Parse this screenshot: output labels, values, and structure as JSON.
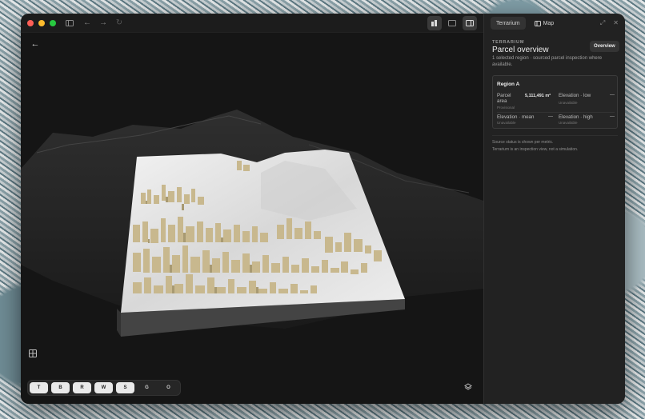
{
  "window": {
    "traffic_lights": [
      "#ff5f57",
      "#febc2e",
      "#28c840"
    ]
  },
  "viewport": {
    "toolbar": {
      "buttons": [
        {
          "label": "T",
          "active": true
        },
        {
          "label": "B",
          "active": true
        },
        {
          "label": "R",
          "active": true
        },
        {
          "label": "W",
          "active": true
        },
        {
          "label": "S",
          "active": true
        },
        {
          "label": "G",
          "active": false
        },
        {
          "label": "O",
          "active": false
        }
      ]
    }
  },
  "panel": {
    "tabs": [
      {
        "label": "Terrarium"
      },
      {
        "label": "Map"
      }
    ],
    "eyebrow": "TERRARIUM",
    "title": "Parcel overview",
    "subtitle": "1 selected region · sourced parcel inspection where available.",
    "overview_button": "Overview",
    "region": {
      "title": "Region A",
      "parcel_area": {
        "label": "Parcel area",
        "value": "5,111,491 m²",
        "status": "Provisional"
      },
      "elevation_low": {
        "label": "Elevation · low",
        "value": "—",
        "status": "Unavailable"
      },
      "elevation_mean": {
        "label": "Elevation · mean",
        "value": "—",
        "status": "Unavailable"
      },
      "elevation_high": {
        "label": "Elevation · high",
        "value": "—",
        "status": "Unavailable"
      }
    },
    "notes": [
      "Source status is shown per metric.",
      "Terrarium is an inspection view, not a simulation."
    ]
  },
  "colors": {
    "building": "#c8b88e",
    "terrain": "#e9e9e9",
    "panel_bg": "#222222"
  }
}
